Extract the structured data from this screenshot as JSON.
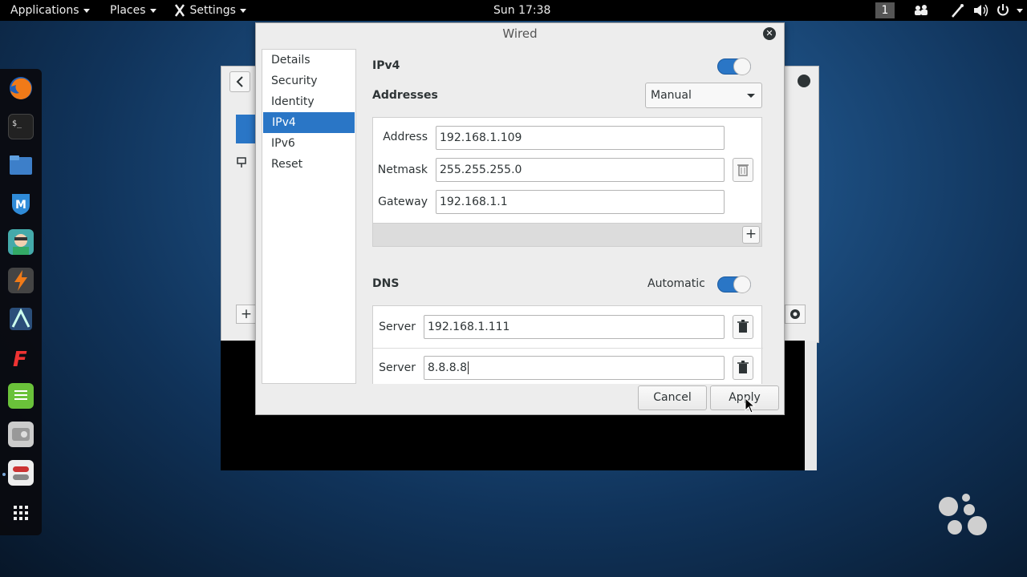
{
  "topbar": {
    "applications": "Applications",
    "places": "Places",
    "settings": "Settings",
    "clock": "Sun 17:38",
    "workspace": "1"
  },
  "dock": {
    "apps": [
      "firefox-icon",
      "terminal-icon",
      "files-icon",
      "metasploit-icon",
      "armitage-icon",
      "burpsuite-icon",
      "maltego-icon",
      "faraday-icon",
      "leafpad-icon",
      "cutycapt-icon",
      "settings-toggle-icon",
      "show-apps-icon"
    ]
  },
  "dialog": {
    "title": "Wired",
    "sidebar": [
      "Details",
      "Security",
      "Identity",
      "IPv4",
      "IPv6",
      "Reset"
    ],
    "selected_index": 3,
    "ipv4_label": "IPv4",
    "ipv4_enabled": true,
    "addresses_label": "Addresses",
    "method": "Manual",
    "address_label": "Address",
    "address_value": "192.168.1.109",
    "netmask_label": "Netmask",
    "netmask_value": "255.255.255.0",
    "gateway_label": "Gateway",
    "gateway_value": "192.168.1.1",
    "add_symbol": "+",
    "dns_label": "DNS",
    "dns_auto_label": "Automatic",
    "dns_auto_enabled": true,
    "server_label": "Server",
    "dns_servers": [
      "192.168.1.111",
      "8.8.8.8"
    ],
    "cancel": "Cancel",
    "apply": "Apply"
  },
  "colors": {
    "accent": "#2a76c6",
    "topbar": "#000000"
  }
}
